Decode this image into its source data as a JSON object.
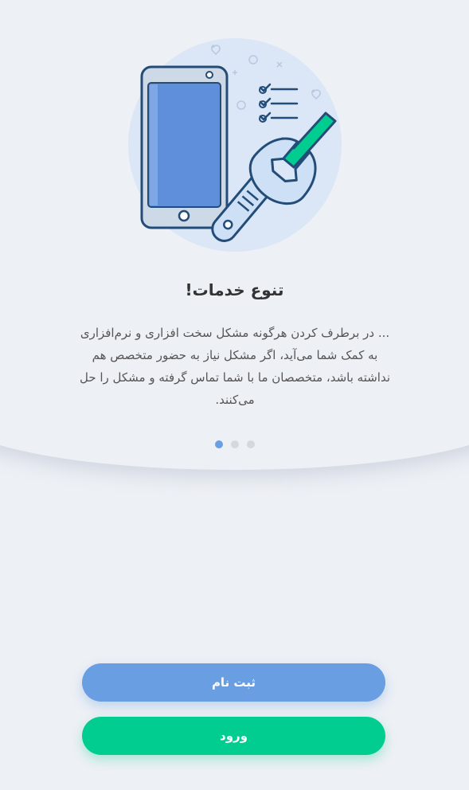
{
  "onboarding": {
    "title": "تنوع خدمات!",
    "description": "... در برطرف کردن هرگونه مشکل سخت افزاری و نرم‌افزاری به کمک شما می‌آید، اگر مشکل نیاز به حضور متخصص هم نداشته باشد، متخصصان ما با شما تماس گرفته و مشکل را حل می‌کنند.",
    "illustration_icon": "phone-repair-illustration",
    "page_indicator": {
      "count": 3,
      "active_index": 0
    }
  },
  "actions": {
    "register_label": "ثبت نام",
    "login_label": "ورود"
  },
  "colors": {
    "background": "#edf0f5",
    "primary": "#6a9ee3",
    "success": "#00cd8f",
    "dot_inactive": "#d5d8de"
  }
}
